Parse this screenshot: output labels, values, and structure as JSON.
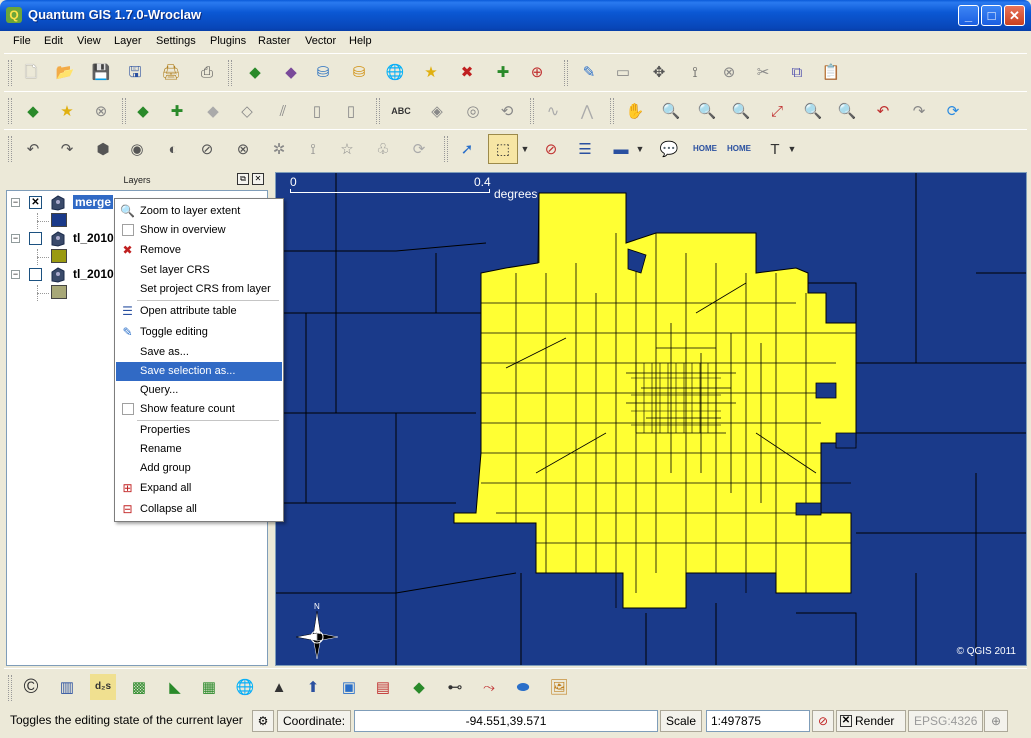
{
  "window": {
    "title": "Quantum GIS 1.7.0-Wroclaw"
  },
  "menubar": {
    "items": [
      "File",
      "Edit",
      "View",
      "Layer",
      "Settings",
      "Plugins",
      "Raster",
      "Vector",
      "Help"
    ]
  },
  "layers_panel": {
    "title": "Layers",
    "layers": [
      {
        "name": "merge",
        "checked": true,
        "selected": true,
        "color": "#1a3a8a"
      },
      {
        "name": "tl_2010",
        "checked": false,
        "selected": false,
        "color": "#9a9a10"
      },
      {
        "name": "tl_2010",
        "checked": false,
        "selected": false,
        "color": "#a8a878"
      }
    ]
  },
  "context_menu": {
    "items": [
      {
        "label": "Zoom to layer extent",
        "icon": "zoom-layer-icon"
      },
      {
        "label": "Show in overview",
        "icon": "checkbox"
      },
      {
        "label": "Remove",
        "icon": "remove-layer-icon"
      },
      {
        "label": "Set layer CRS",
        "icon": ""
      },
      {
        "label": "Set project CRS from layer",
        "icon": ""
      },
      {
        "label": "Open attribute table",
        "icon": "attribute-table-icon"
      },
      {
        "label": "Toggle editing",
        "icon": "pencil-icon"
      },
      {
        "label": "Save as...",
        "icon": ""
      },
      {
        "label": "Save selection as...",
        "icon": "",
        "highlighted": true
      },
      {
        "label": "Query...",
        "icon": ""
      },
      {
        "label": "Show feature count",
        "icon": "checkbox"
      },
      {
        "label": "Properties",
        "icon": ""
      },
      {
        "label": "Rename",
        "icon": ""
      },
      {
        "label": "Add group",
        "icon": ""
      },
      {
        "label": "Expand all",
        "icon": "expand-icon"
      },
      {
        "label": "Collapse all",
        "icon": "collapse-icon"
      }
    ]
  },
  "map": {
    "scale_start": "0",
    "scale_end": "0.4",
    "scale_unit": "degrees",
    "copyright": "© QGIS 2011",
    "fill_selected": "#ffff33",
    "fill_unselected": "#1a3a8a"
  },
  "statusbar": {
    "message": "Toggles the editing state of the current layer",
    "coordinate_label": "Coordinate:",
    "coordinate_value": "-94.551,39.571",
    "scale_label": "Scale",
    "scale_value": "1:497875",
    "render_label": "Render",
    "epsg_label": "EPSG:4326"
  }
}
